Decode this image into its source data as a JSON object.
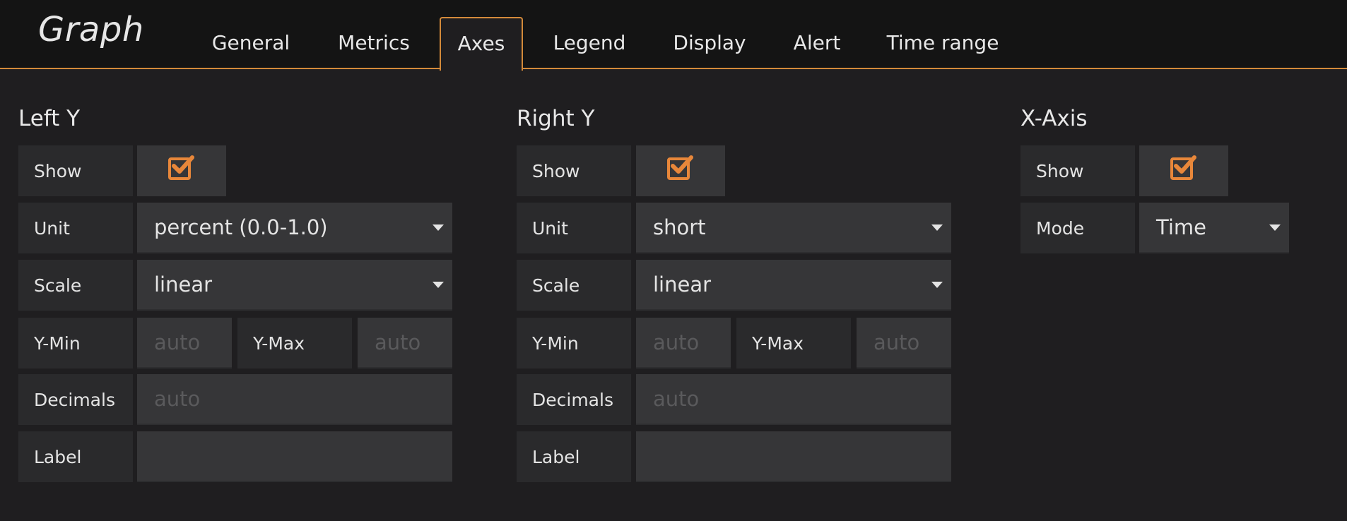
{
  "app": {
    "title": "Graph"
  },
  "tabs": [
    {
      "label": "General"
    },
    {
      "label": "Metrics"
    },
    {
      "label": "Axes"
    },
    {
      "label": "Legend"
    },
    {
      "label": "Display"
    },
    {
      "label": "Alert"
    },
    {
      "label": "Time range"
    }
  ],
  "active_tab": "Axes",
  "colors": {
    "accent": "#d48a3a",
    "checkbox": "#e8873a",
    "background": "#1f1e20"
  },
  "left_y": {
    "title": "Left Y",
    "show_label": "Show",
    "show": true,
    "unit_label": "Unit",
    "unit_value": "percent (0.0-1.0)",
    "scale_label": "Scale",
    "scale_value": "linear",
    "ymin_label": "Y-Min",
    "ymin_placeholder": "auto",
    "ymax_label": "Y-Max",
    "ymax_placeholder": "auto",
    "decimals_label": "Decimals",
    "decimals_placeholder": "auto",
    "label_label": "Label",
    "label_value": ""
  },
  "right_y": {
    "title": "Right Y",
    "show_label": "Show",
    "show": true,
    "unit_label": "Unit",
    "unit_value": "short",
    "scale_label": "Scale",
    "scale_value": "linear",
    "ymin_label": "Y-Min",
    "ymin_placeholder": "auto",
    "ymax_label": "Y-Max",
    "ymax_placeholder": "auto",
    "decimals_label": "Decimals",
    "decimals_placeholder": "auto",
    "label_label": "Label",
    "label_value": ""
  },
  "x_axis": {
    "title": "X-Axis",
    "show_label": "Show",
    "show": true,
    "mode_label": "Mode",
    "mode_value": "Time"
  }
}
